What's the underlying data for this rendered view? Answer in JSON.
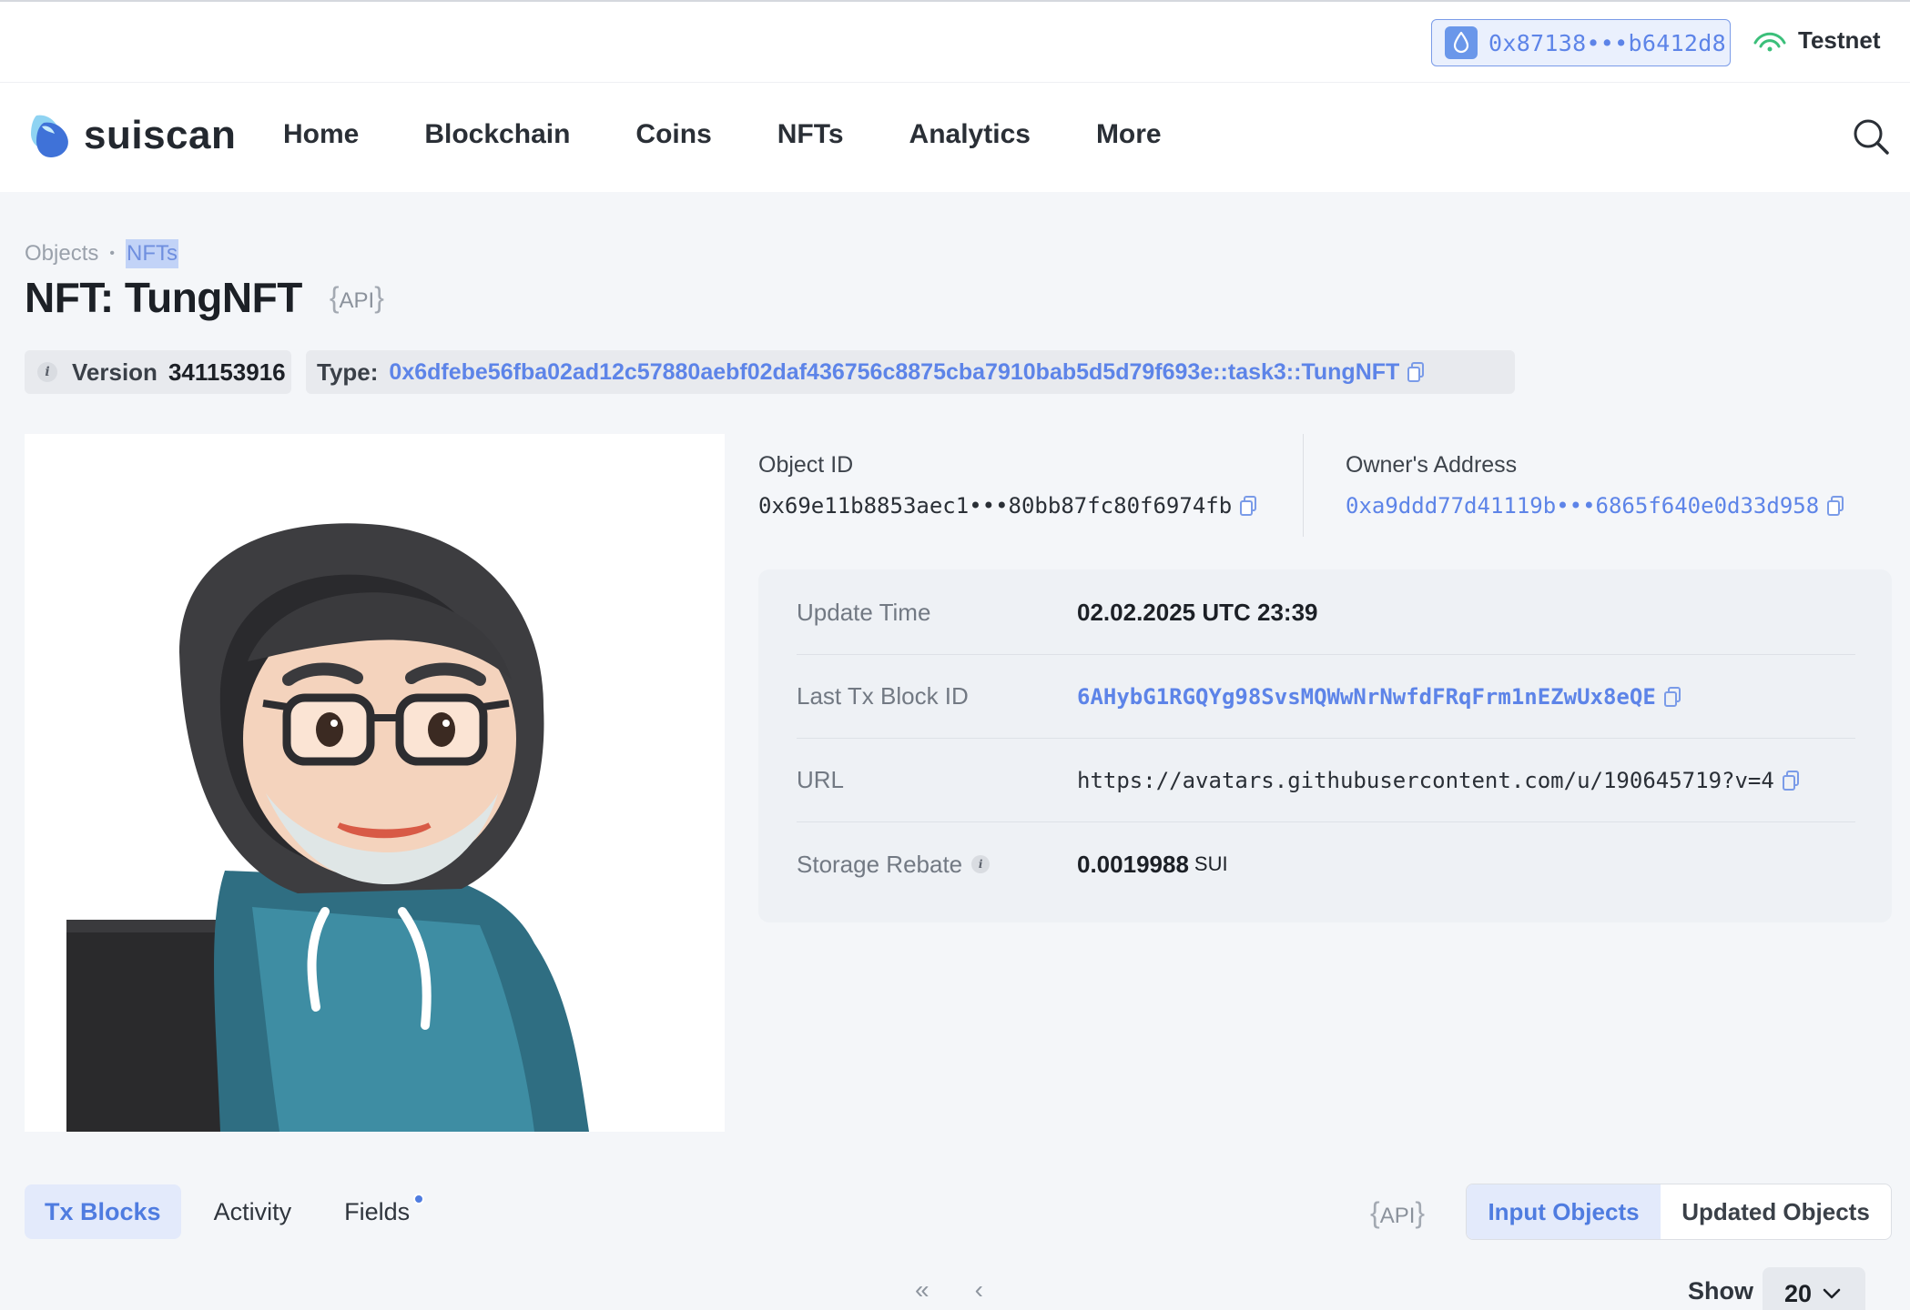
{
  "wallet": {
    "address": "0x87138•••b6412d8"
  },
  "network": {
    "name": "Testnet"
  },
  "brand": {
    "name": "suiscan"
  },
  "nav": {
    "items": [
      "Home",
      "Blockchain",
      "Coins",
      "NFTs",
      "Analytics",
      "More"
    ]
  },
  "breadcrumb": {
    "items": [
      "Objects",
      "NFTs"
    ],
    "separator": "•"
  },
  "page": {
    "title": "NFT: TungNFT",
    "api_label": "API"
  },
  "version": {
    "label": "Version",
    "value": "341153916"
  },
  "type": {
    "label": "Type:",
    "value": "0x6dfebe56fba02ad12c57880aebf02daf436756c8875cba7910bab5d5d79f693e::task3::TungNFT"
  },
  "object": {
    "label": "Object ID",
    "value": "0x69e11b8853aec1•••80bb87fc80f6974fb"
  },
  "owner": {
    "label": "Owner's Address",
    "value": "0xa9ddd77d41119b•••6865f640e0d33d958"
  },
  "details": {
    "update_time_label": "Update Time",
    "update_time": "02.02.2025 UTC 23:39",
    "last_tx_label": "Last Tx Block ID",
    "last_tx": "6AHybG1RGQYg98SvsMQWwNrNwfdFRqFrm1nEZwUx8eQE",
    "url_label": "URL",
    "url": "https://avatars.githubusercontent.com/u/190645719?v=4",
    "rebate_label": "Storage Rebate",
    "rebate_value": "0.0019988",
    "rebate_unit": "SUI"
  },
  "tabs": [
    "Tx Blocks",
    "Activity",
    "Fields"
  ],
  "segment": {
    "options": [
      "Input Objects",
      "Updated Objects"
    ],
    "active": "Input Objects"
  },
  "pagination": {
    "first": "«",
    "prev": "‹",
    "show_label": "Show",
    "page_size": "20"
  },
  "colors": {
    "accent": "#5d84e8",
    "active_bg": "#e3eafb",
    "testnet": "#3bbf7a"
  }
}
